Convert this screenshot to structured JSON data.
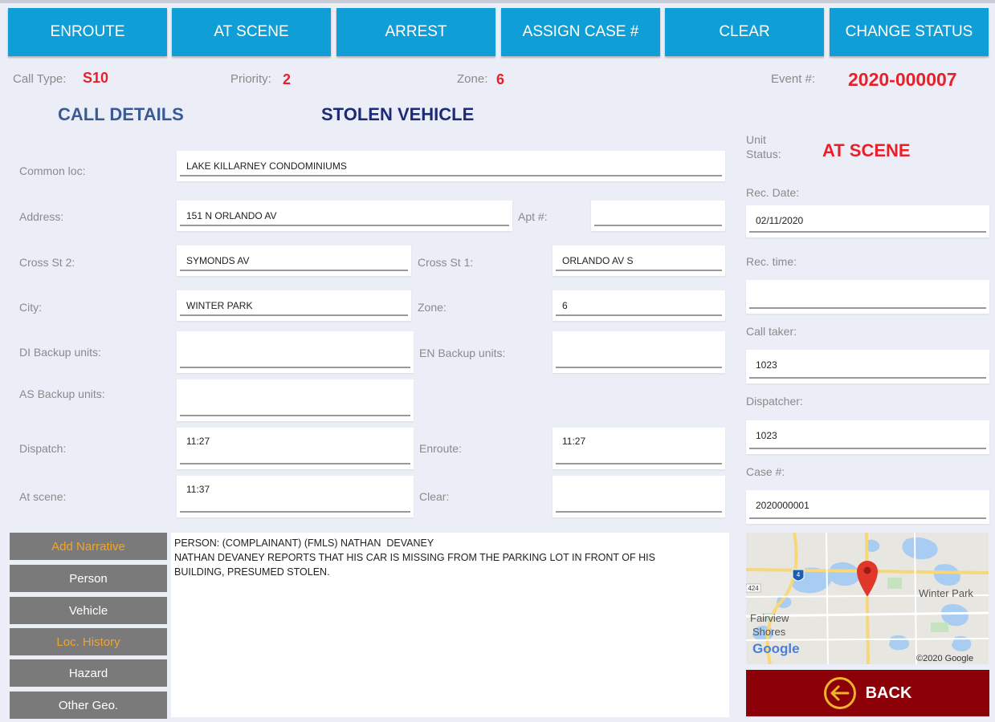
{
  "toolbar": {
    "enroute": "ENROUTE",
    "at_scene": "AT SCENE",
    "arrest": "ARREST",
    "assign_case": "ASSIGN CASE #",
    "clear": "CLEAR",
    "change_status": "CHANGE STATUS"
  },
  "header": {
    "call_type_label": "Call Type:",
    "call_type_value": "S10",
    "priority_label": "Priority:",
    "priority_value": "2",
    "zone_label": "Zone:",
    "zone_value": "6",
    "event_label": "Event #:",
    "event_value": "2020-000007"
  },
  "titles": {
    "call_details": "CALL DETAILS",
    "call_kind": "STOLEN VEHICLE"
  },
  "form": {
    "common_loc_label": "Common loc:",
    "common_loc": "LAKE KILLARNEY CONDOMINIUMS",
    "address_label": "Address:",
    "address": "151 N ORLANDO AV",
    "apt_label": "Apt #:",
    "apt": "",
    "cross2_label": "Cross St 2:",
    "cross2": "SYMONDS AV",
    "cross1_label": "Cross St 1:",
    "cross1": "ORLANDO AV S",
    "city_label": "City:",
    "city": "WINTER PARK",
    "zone_label": "Zone:",
    "zone": "6",
    "di_backup_label": "DI Backup units:",
    "di_backup": "",
    "en_backup_label": "EN Backup units:",
    "en_backup": "",
    "as_backup_label": "AS Backup units:",
    "as_backup": "",
    "dispatch_label": "Dispatch:",
    "dispatch": "11:27",
    "enroute_label": "Enroute:",
    "enroute": "11:27",
    "at_scene_label": "At scene:",
    "at_scene": "11:37",
    "clear_label": "Clear:",
    "clear": ""
  },
  "right": {
    "unit_status_label_1": "Unit",
    "unit_status_label_2": "Status:",
    "unit_status": "AT SCENE",
    "rec_date_label": "Rec. Date:",
    "rec_date": "02/11/2020",
    "rec_time_label": "Rec. time:",
    "rec_time": "",
    "call_taker_label": "Call taker:",
    "call_taker": "1023",
    "dispatcher_label": "Dispatcher:",
    "dispatcher": "1023",
    "case_label": "Case #:",
    "case": "2020000001"
  },
  "side_buttons": {
    "add_narrative": "Add Narrative",
    "person": "Person",
    "vehicle": "Vehicle",
    "loc_history": "Loc. History",
    "hazard": "Hazard",
    "other_geo": "Other Geo."
  },
  "narrative": "PERSON: (COMPLAINANT) (FMLS) NATHAN  DEVANEY\nNATHAN DEVANEY REPORTS THAT HIS CAR IS MISSING FROM THE PARKING LOT IN FRONT OF HIS\nBUILDING, PRESUMED STOLEN.",
  "map": {
    "label_winter_park": "Winter Park",
    "label_fairview_1": "Fairview",
    "label_fairview_2": "Shores",
    "shield_4": "4",
    "shield_424": "424",
    "google": "Google",
    "copyright": "©2020 Google"
  },
  "back_label": "BACK",
  "colors": {
    "accent_blue": "#0f9fd6",
    "alert_red": "#e8202a",
    "back_red": "#8c0008",
    "heading_blue": "#3a5a96",
    "heading_navy": "#1c2a7a"
  }
}
